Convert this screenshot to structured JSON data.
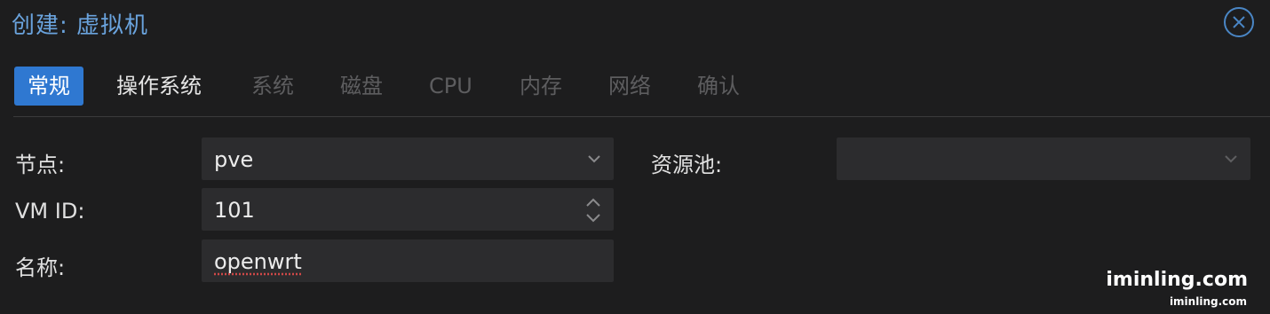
{
  "window": {
    "title": "创建: 虚拟机",
    "close_icon": "close-circle-icon",
    "accent_color": "#2f78d1"
  },
  "tabs": [
    {
      "label": "常规",
      "state": "active"
    },
    {
      "label": "操作系统",
      "state": "enabled"
    },
    {
      "label": "系统",
      "state": "disabled"
    },
    {
      "label": "磁盘",
      "state": "disabled"
    },
    {
      "label": "CPU",
      "state": "disabled"
    },
    {
      "label": "内存",
      "state": "disabled"
    },
    {
      "label": "网络",
      "state": "disabled"
    },
    {
      "label": "确认",
      "state": "disabled"
    }
  ],
  "form": {
    "node": {
      "label": "节点:",
      "value": "pve",
      "icon": "chevron-down-icon"
    },
    "vmid": {
      "label": "VM ID:",
      "value": "101",
      "icon": "spinner-icon"
    },
    "name": {
      "label": "名称:",
      "value": "openwrt"
    },
    "pool": {
      "label": "资源池:",
      "value": "",
      "icon": "chevron-down-icon"
    }
  },
  "watermark": {
    "large": "iminling.com",
    "small": "iminling.com"
  }
}
